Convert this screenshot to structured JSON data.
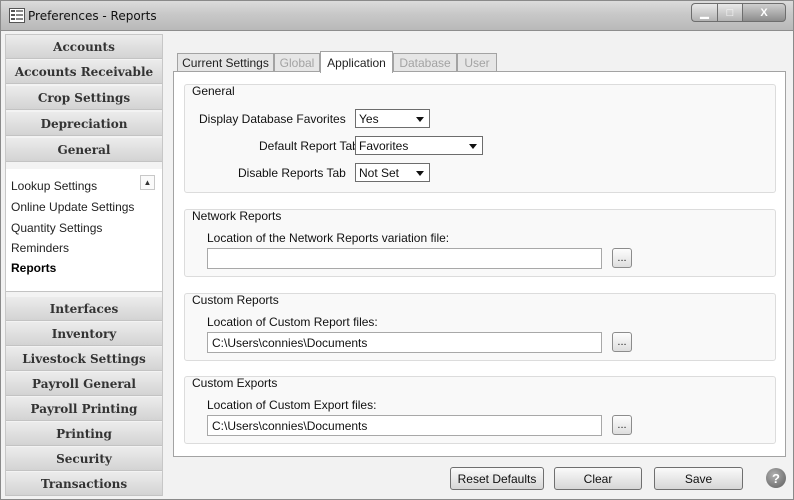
{
  "window": {
    "title": "Preferences - Reports",
    "minimize_glyph": "▁",
    "maximize_glyph": "□",
    "close_glyph": "X"
  },
  "sidebar": {
    "categories_top": [
      "Accounts",
      "Accounts Receivable",
      "Crop Settings",
      "Depreciation",
      "General"
    ],
    "subitems": [
      "Lookup Settings",
      "Online Update Settings",
      "Quantity Settings",
      "Reminders",
      "Reports"
    ],
    "active_subitem": "Reports",
    "categories_bottom": [
      "Interfaces",
      "Inventory",
      "Livestock Settings",
      "Payroll General",
      "Payroll Printing",
      "Printing",
      "Security",
      "Transactions"
    ]
  },
  "tabs": [
    {
      "label": "Current Settings",
      "state": "normal"
    },
    {
      "label": "Global",
      "state": "disabled"
    },
    {
      "label": "Application",
      "state": "active"
    },
    {
      "label": "Database",
      "state": "disabled"
    },
    {
      "label": "User",
      "state": "disabled"
    }
  ],
  "general": {
    "title": "General",
    "display_favorites_label": "Display Database Favorites",
    "display_favorites_value": "Yes",
    "default_tab_label": "Default Report Tab",
    "default_tab_value": "Favorites",
    "disable_tab_label": "Disable Reports Tab",
    "disable_tab_value": "Not Set"
  },
  "network": {
    "title": "Network Reports",
    "label": "Location of the Network Reports variation file:",
    "value": "",
    "browse_label": "..."
  },
  "custom_reports": {
    "title": "Custom Reports",
    "label": "Location of Custom Report files:",
    "value": "C:\\Users\\connies\\Documents",
    "browse_label": "..."
  },
  "custom_exports": {
    "title": "Custom Exports",
    "label": "Location of Custom Export files:",
    "value": "C:\\Users\\connies\\Documents",
    "browse_label": "..."
  },
  "footer": {
    "reset_label": "Reset Defaults",
    "clear_label": "Clear",
    "save_label": "Save",
    "help_glyph": "?"
  },
  "icons": {
    "app": "preferences-list-icon",
    "scroll": "scroll-up-icon",
    "dropdown": "chevron-down-icon",
    "help": "help-icon"
  }
}
